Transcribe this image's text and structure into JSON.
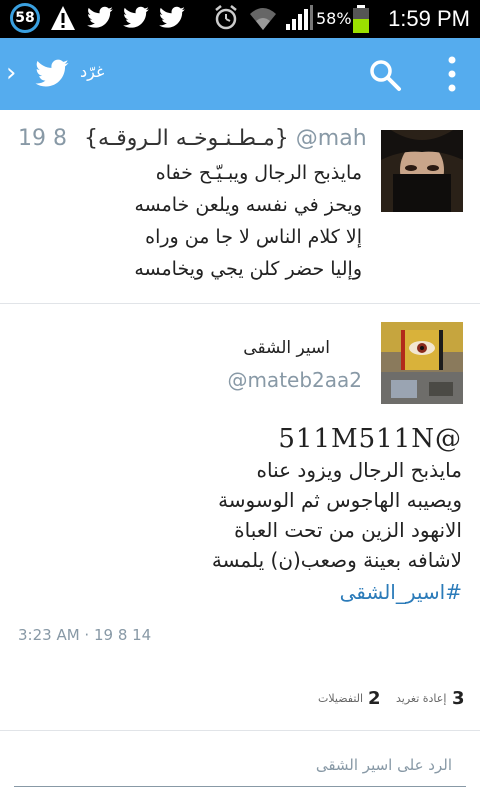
{
  "status_bar": {
    "notification_count": "58",
    "battery": "58%",
    "time": "1:59 PM"
  },
  "action_bar": {
    "title": "غرّد",
    "back_glyph": "›"
  },
  "previous_tweet": {
    "handle": "@maha...",
    "name": "{مـطـنـوخـه الـروقـه}",
    "time": "19 8",
    "lines": [
      "مايذبح الرجال ويبـيّـح خفاه",
      "ويحز في نفسه ويلعن خامسه",
      "إلا كلام الناس لا جا من وراه",
      "وإليا حضر كلن يجي ويخامسه"
    ]
  },
  "main_tweet": {
    "name": "اسير الشقى",
    "handle": "@mateb2aa2",
    "mention": "511M511N@",
    "lines": [
      "مايذبح الرجال ويزود عناه",
      "ويصيبه الهاجوس ثم الوسوسة",
      "الانهود الزين من تحت العباة",
      "لاشافه بعينة وصعب(ن) يلمسة"
    ],
    "hashtag": "#اسير_الشقى",
    "timestamp": "3:23 AM · 19 8 14"
  },
  "stats": {
    "retweets_count": "3",
    "retweets_label": "إعادة تغريد",
    "favorites_count": "2",
    "favorites_label": "التفضيلات"
  },
  "reply": {
    "placeholder": "الرد على اسير الشقى"
  },
  "colors": {
    "accent": "#55acee",
    "link": "#2b7bb9",
    "muted": "#8899a6"
  }
}
